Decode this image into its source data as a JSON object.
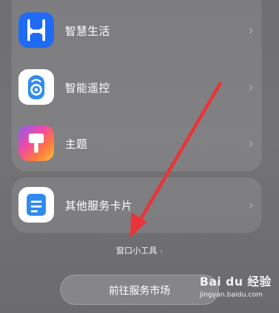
{
  "services": [
    {
      "label": "智慧生活",
      "icon": "smart-life-icon"
    },
    {
      "label": "智能遥控",
      "icon": "remote-control-icon"
    },
    {
      "label": "主题",
      "icon": "theme-brush-icon"
    }
  ],
  "other_services": {
    "label": "其他服务卡片",
    "icon": "service-card-icon"
  },
  "widget_link": {
    "label": "窗口小工具"
  },
  "market_button": {
    "label": "前往服务市场"
  },
  "watermark": {
    "brand": "Bai du 经验",
    "url": "jingyan.baidu.com"
  },
  "colors": {
    "accent_arrow": "#e8343a",
    "smart_life_bg": "#1f6bf5"
  }
}
